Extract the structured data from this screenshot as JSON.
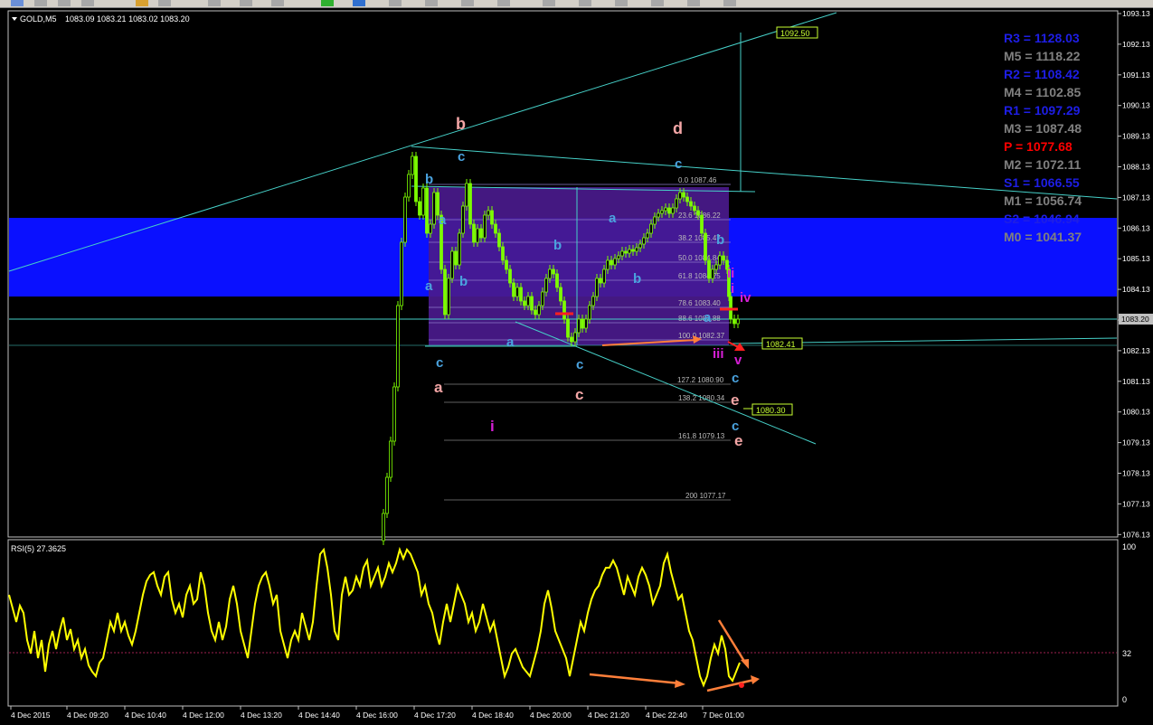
{
  "toolbar": {
    "buttons": [
      "new-chart",
      "open",
      "save",
      "separator",
      "zoom",
      "separator",
      "line",
      "separator",
      "indicator-plus",
      "cursor",
      "separator",
      "chart-props"
    ]
  },
  "chart": {
    "symbol_label": "GOLD,M5",
    "ohlc": "1083.09 1083.21 1083.02 1083.20",
    "ylim": [
      1076.13,
      1093.13
    ],
    "price_ticks": [
      "1093.13",
      "1092.13",
      "1091.13",
      "1090.13",
      "1089.13",
      "1088.13",
      "1087.13",
      "1086.13",
      "1085.13",
      "1084.13",
      "1083.13",
      "1082.13",
      "1081.13",
      "1080.13",
      "1079.13",
      "1078.13",
      "1077.13",
      "1076.13"
    ],
    "current_price": "1083.20",
    "time_labels": [
      "4 Dec 2015",
      "4 Dec 09:20",
      "4 Dec 10:40",
      "4 Dec 12:00",
      "4 Dec 13:20",
      "4 Dec 14:40",
      "4 Dec 16:00",
      "4 Dec 17:20",
      "4 Dec 18:40",
      "4 Dec 20:00",
      "4 Dec 21:20",
      "4 Dec 22:40",
      "7 Dec 01:00"
    ],
    "price_tags": {
      "upper": "1092.50",
      "mid": "1082.41",
      "lower": "1080.30"
    },
    "fib_levels": [
      {
        "label": "0.0",
        "price": "1087.46"
      },
      {
        "label": "23.6",
        "price": "1086.22"
      },
      {
        "label": "38.2",
        "price": "1085.47"
      },
      {
        "label": "50.0",
        "price": "1084.84"
      },
      {
        "label": "61.8",
        "price": "1084.25"
      },
      {
        "label": "78.6",
        "price": "1083.40"
      },
      {
        "label": "88.6",
        "price": "1082.88"
      },
      {
        "label": "100.0",
        "price": "1082.37"
      },
      {
        "label": "127.2",
        "price": "1080.90"
      },
      {
        "label": "138.2",
        "price": "1080.34"
      },
      {
        "label": "161.8",
        "price": "1079.13"
      },
      {
        "label": "200",
        "price": "1077.17"
      }
    ],
    "pivots": [
      {
        "label": "R3 = 1128.03",
        "color": "#1e1ee6"
      },
      {
        "label": "M5 = 1118.22",
        "color": "#808080"
      },
      {
        "label": "R2 = 1108.42",
        "color": "#1e1ee6"
      },
      {
        "label": "M4 = 1102.85",
        "color": "#808080"
      },
      {
        "label": "R1 = 1097.29",
        "color": "#1e1ee6"
      },
      {
        "label": "M3 = 1087.48",
        "color": "#808080"
      },
      {
        "label": "P   = 1077.68",
        "color": "#ff0000"
      },
      {
        "label": "M2 = 1072.11",
        "color": "#808080"
      },
      {
        "label": "S1 = 1066.55",
        "color": "#1e1ee6"
      },
      {
        "label": "M1 = 1056.74",
        "color": "#808080"
      },
      {
        "label": "S2 = 1046.94",
        "color": "#1e1ee6"
      },
      {
        "label": "M0 = 1041.37",
        "color": "#808080"
      }
    ],
    "wave_labels": [
      {
        "t": "b",
        "c": "#f4a6a6"
      },
      {
        "t": "d",
        "c": "#f4a6a6"
      },
      {
        "t": "c",
        "c": "#4aa3df"
      },
      {
        "t": "b",
        "c": "#4aa3df"
      },
      {
        "t": "c",
        "c": "#4aa3df"
      },
      {
        "t": "a",
        "c": "#4aa3df"
      },
      {
        "t": "a",
        "c": "#4aa3df"
      },
      {
        "t": "b",
        "c": "#4aa3df"
      },
      {
        "t": "a",
        "c": "#4aa3df"
      },
      {
        "t": "b",
        "c": "#4aa3df"
      },
      {
        "t": "b",
        "c": "#4aa3df"
      },
      {
        "t": "b",
        "c": "#4aa3df"
      },
      {
        "t": "ii",
        "c": "#d61fd6"
      },
      {
        "t": "i",
        "c": "#d61fd6"
      },
      {
        "t": "iv",
        "c": "#d61fd6"
      },
      {
        "t": "a",
        "c": "#4aa3df"
      },
      {
        "t": "a",
        "c": "#4aa3df"
      },
      {
        "t": "iii",
        "c": "#d61fd6"
      },
      {
        "t": "v",
        "c": "#d61fd6"
      },
      {
        "t": "c",
        "c": "#4aa3df"
      },
      {
        "t": "c",
        "c": "#4aa3df"
      },
      {
        "t": "c",
        "c": "#4aa3df"
      },
      {
        "t": "a",
        "c": "#f4a6a6"
      },
      {
        "t": "c",
        "c": "#f4a6a6"
      },
      {
        "t": "e",
        "c": "#f4a6a6"
      },
      {
        "t": "i",
        "c": "#d61fd6"
      },
      {
        "t": "c",
        "c": "#4aa3df"
      },
      {
        "t": "e",
        "c": "#f4a6a6"
      }
    ]
  },
  "rsi": {
    "label": "RSI(5) 27.3625",
    "ticks": [
      "100",
      "32",
      "0"
    ]
  },
  "colors": {
    "background": "#000000",
    "candle": "#7CFC00",
    "rsi_line": "#ffff00",
    "blue_band": "#0a10ff",
    "purple_box": "#4a1a8c",
    "trend_line": "#46d0c8",
    "arrow": "#ff7f3a"
  }
}
